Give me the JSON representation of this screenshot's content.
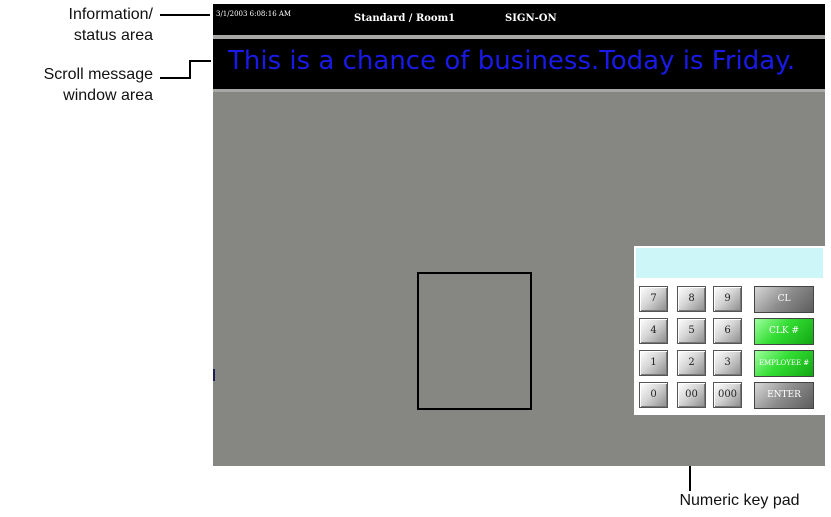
{
  "annotations": {
    "info_line1": "Information/",
    "info_line2": "status area",
    "scroll_line1": "Scroll message",
    "scroll_line2": "window area",
    "keypad_label": "Numeric key pad"
  },
  "status_bar": {
    "datetime": "3/1/2003 6:08:16 AM",
    "mode": "Standard / Room1",
    "state": "SIGN-ON"
  },
  "scroll_message": {
    "text": "This is a chance of business.Today is Friday."
  },
  "keypad": {
    "display_value": "",
    "keys": [
      "7",
      "8",
      "9",
      "4",
      "5",
      "6",
      "1",
      "2",
      "3",
      "0",
      "00",
      "000"
    ],
    "function_keys": {
      "clear": "CL",
      "clock": "CLK #",
      "employee": "EMPLOYEE #",
      "enter": "ENTER"
    }
  },
  "colors": {
    "screen_background": "#868683",
    "scroll_text": "#1a1ae8",
    "display_background": "#ccf6f8",
    "green_key": "#33dd33"
  }
}
